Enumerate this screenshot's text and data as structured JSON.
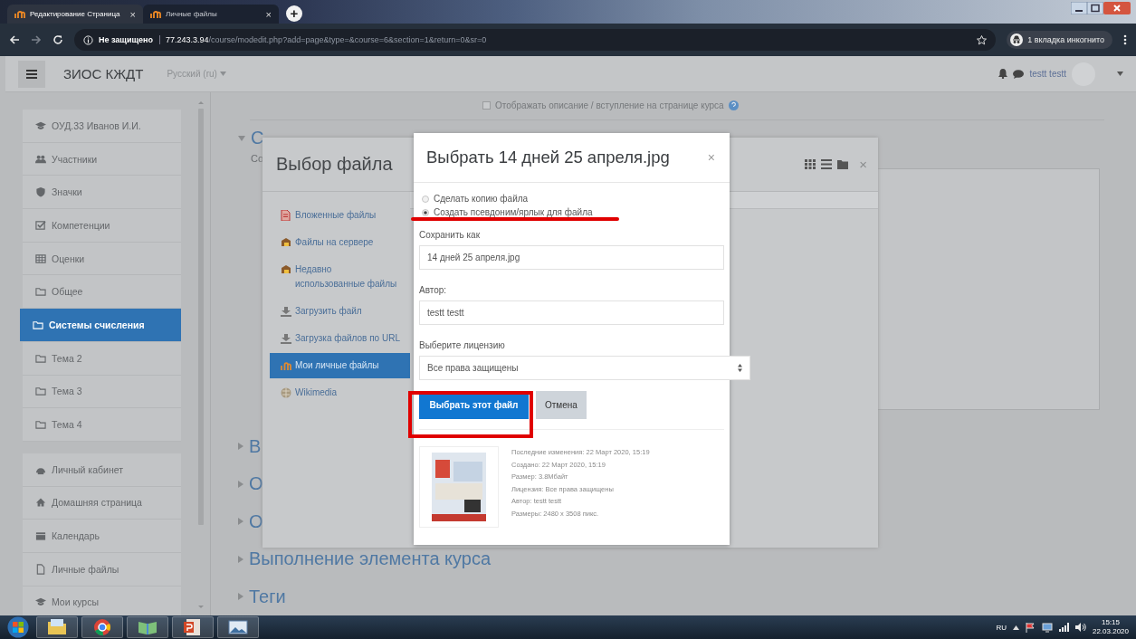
{
  "browser": {
    "tabs": [
      {
        "title": "Редактирование Страница",
        "close": "×",
        "selected": true
      },
      {
        "title": "Личные файлы",
        "close": "×",
        "selected": false
      }
    ],
    "new_tab": "+",
    "security": "Не защищено",
    "url_host": "77.243.3.94",
    "url_path": "/course/modedit.php?add=page&type=&course=6&section=1&return=0&sr=0",
    "incognito": "1 вкладка инкогнито"
  },
  "navbar": {
    "site_name": "ЗИОС КЖДТ",
    "language": "Русский (ru)",
    "user_name": "testt testt"
  },
  "sidebar": {
    "groups": [
      [
        {
          "label": "ОУД.33 Иванов И.И.",
          "selected": false
        },
        {
          "label": "Участники",
          "selected": false
        },
        {
          "label": "Значки",
          "selected": false
        },
        {
          "label": "Компетенции",
          "selected": false
        },
        {
          "label": "Оценки",
          "selected": false
        },
        {
          "label": "Общее",
          "selected": false
        },
        {
          "label": "Системы счисления",
          "selected": true
        },
        {
          "label": "Тема 2",
          "selected": false
        },
        {
          "label": "Тема 3",
          "selected": false
        },
        {
          "label": "Тема 4",
          "selected": false
        }
      ],
      [
        {
          "label": "Личный кабинет",
          "selected": false
        },
        {
          "label": "Домашняя страница",
          "selected": false
        },
        {
          "label": "Календарь",
          "selected": false
        },
        {
          "label": "Личные файлы",
          "selected": false
        },
        {
          "label": "Мои курсы",
          "selected": false
        }
      ]
    ]
  },
  "main": {
    "show_description": {
      "label": "Отображать описание / вступление на странице курса",
      "checked": false
    },
    "sections": [
      {
        "title": "С",
        "summary": "Со",
        "expanded": true
      },
      {
        "title": "В",
        "expanded": false
      },
      {
        "title": "О",
        "expanded": false
      },
      {
        "title": "О",
        "expanded": false
      },
      {
        "title": "Выполнение элемента курса",
        "expanded": false
      },
      {
        "title": "Теги",
        "expanded": false
      }
    ]
  },
  "file_picker": {
    "title": "Выбор файла",
    "close": "×",
    "repositories": [
      {
        "label": "Вложенные файлы",
        "selected": false
      },
      {
        "label": "Файлы на сервере",
        "selected": false
      },
      {
        "label": "Недавно использованные файлы",
        "selected": false
      },
      {
        "label": "Загрузить файл",
        "selected": false
      },
      {
        "label": "Загрузка файлов по URL",
        "selected": false
      },
      {
        "label": "Мои личные файлы",
        "selected": true
      },
      {
        "label": "Wikimedia",
        "selected": false
      }
    ]
  },
  "dialog": {
    "title": "Выбрать 14 дней 25 апреля.jpg",
    "close": "×",
    "options": [
      {
        "label": "Сделать копию файла",
        "selected": false
      },
      {
        "label": "Создать псевдоним/ярлык для файла",
        "selected": true
      }
    ],
    "fields": [
      {
        "label": "Сохранить как",
        "value": "14 дней 25 апреля.jpg"
      },
      {
        "label": "Автор:",
        "value": "testt testt"
      }
    ],
    "license": {
      "label": "Выберите лицензию",
      "value": "Все права защищены"
    },
    "buttons": [
      {
        "label": "Выбрать этот файл",
        "kind": "primary"
      },
      {
        "label": "Отмена",
        "kind": "secondary"
      }
    ],
    "details": [
      "Последние изменения: 22 Март 2020, 15:19",
      "Создано: 22 Март 2020, 15:19",
      "Размер: 3.8Мбайт",
      "Лицензия: Все права защищены",
      "Автор: testt testt",
      "Размеры: 2480 х 3508 пикс."
    ]
  },
  "taskbar": {
    "language": "RU",
    "time": "15:15",
    "date": "22.03.2020"
  }
}
